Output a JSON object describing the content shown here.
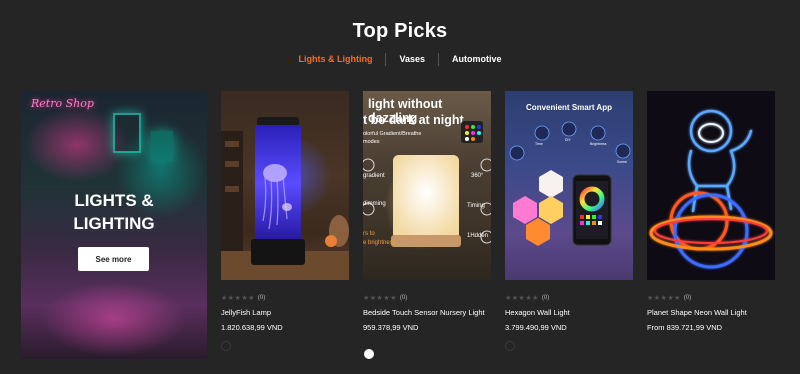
{
  "section_title": "Top Picks",
  "tabs": [
    {
      "label": "Lights & Lighting",
      "active": true
    },
    {
      "label": "Vases",
      "active": false
    },
    {
      "label": "Automotive",
      "active": false
    }
  ],
  "hero": {
    "heading_line1": "LIGHTS &",
    "heading_line2": "LIGHTING",
    "button_label": "See more",
    "sign_text": "Retro Shop"
  },
  "products": [
    {
      "name": "JellyFish Lamp",
      "price": "1.820.638,99 VND",
      "rating_count": "(0)"
    },
    {
      "name": "Bedside Touch Sensor Nursery Light",
      "price": "959.378,99 VND",
      "rating_count": "(0)"
    },
    {
      "name": "Hexagon Wall Light",
      "price": "3.799.490,99 VND",
      "rating_count": "(0)"
    },
    {
      "name": "Planet Shape Neon Wall Light",
      "price": "From 839.721,99 VND",
      "rating_count": "(0)"
    }
  ],
  "image_text": {
    "bedside_line1": "light without dazzling",
    "bedside_line2": "t be dark at night",
    "bedside_line3": "olorful Gradient/Breathe",
    "bedside_line4": "modes",
    "bedside_left1": "gradient",
    "bedside_left2": "dimming",
    "bedside_left3": "rs to",
    "bedside_left4": "e brightness",
    "bedside_right1": "360°",
    "bedside_right2": "Timing",
    "bedside_right3": "1Hdden",
    "hexagon_heading": "Convenient Smart App",
    "hexagon_icon1": "Time",
    "hexagon_icon2": "DIY",
    "hexagon_icon3": "Brightness",
    "hexagon_icon4": "Scene"
  },
  "colors": {
    "accent": "#ff6a13",
    "background": "#252525"
  }
}
